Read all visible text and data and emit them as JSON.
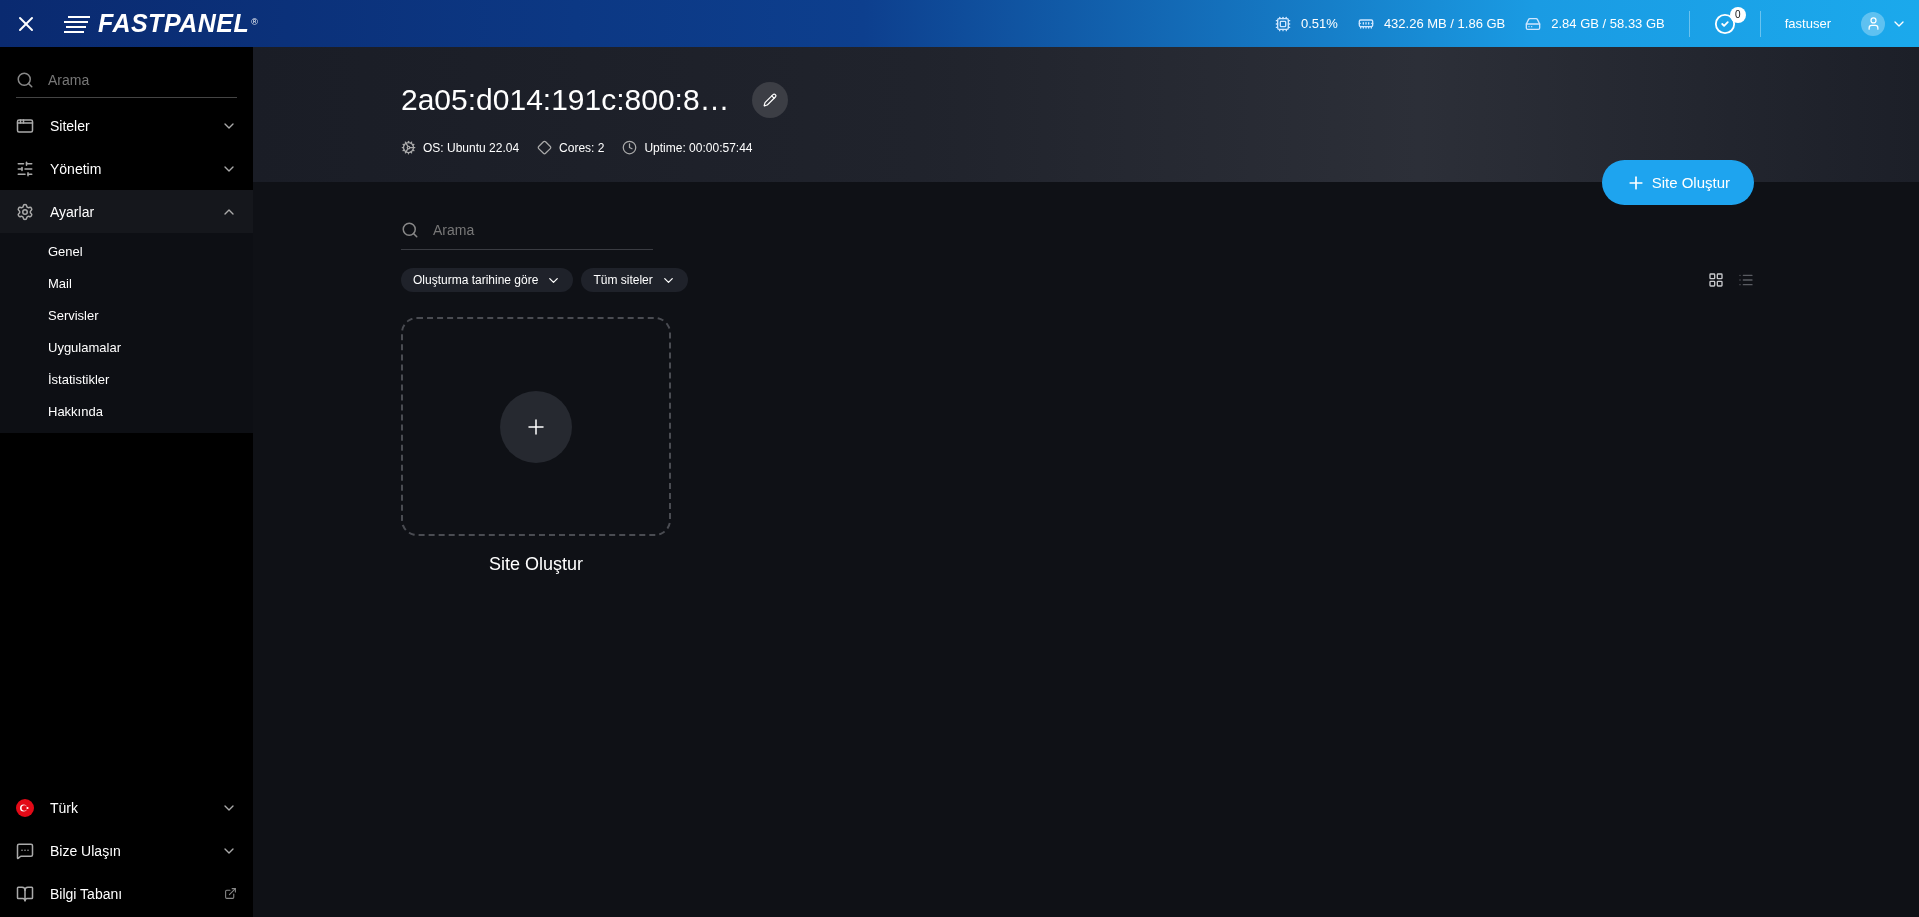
{
  "topbar": {
    "logo": {
      "text": "FASTPANEL",
      "mark": "®"
    },
    "stats": [
      {
        "kind": "cpu",
        "value": "0.51%"
      },
      {
        "kind": "memory",
        "value": "432.26 MB / 1.86 GB"
      },
      {
        "kind": "disk",
        "value": "2.84 GB / 58.33 GB"
      }
    ],
    "tasks_badge": "0",
    "user": "fastuser"
  },
  "sidebar": {
    "search": {
      "placeholder": "Arama"
    },
    "items": [
      {
        "label": "Siteler",
        "expanded": false
      },
      {
        "label": "Yönetim",
        "expanded": false
      },
      {
        "label": "Ayarlar",
        "expanded": true,
        "children": [
          {
            "label": "Genel"
          },
          {
            "label": "Mail"
          },
          {
            "label": "Servisler"
          },
          {
            "label": "Uygulamalar"
          },
          {
            "label": "İstatistikler"
          },
          {
            "label": "Hakkında"
          }
        ]
      }
    ],
    "bottom_items": [
      {
        "label": "Türk",
        "kind": "dropdown"
      },
      {
        "label": "Bize Ulaşın",
        "kind": "dropdown"
      },
      {
        "label": "Bilgi Tabanı",
        "kind": "external"
      }
    ]
  },
  "server": {
    "title": "2a05:d014:191c:800:8…",
    "os": "OS: Ubuntu 22.04",
    "cores": "Cores: 2",
    "uptime": "Uptime: 00:00:57:44"
  },
  "create_button": "Site Oluştur",
  "search": {
    "placeholder": "Arama"
  },
  "filters": [
    "Oluşturma tarihine göre",
    "Tüm siteler"
  ],
  "views": [
    {
      "kind": "grid",
      "selected": true
    },
    {
      "kind": "list",
      "selected": false
    }
  ],
  "new_site_card": {
    "label": "Site Oluştur"
  }
}
